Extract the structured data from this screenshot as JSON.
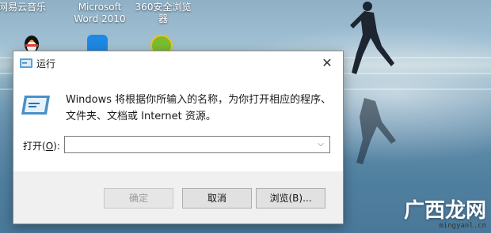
{
  "desktop": {
    "icons": [
      {
        "label": "网易云音乐"
      },
      {
        "label": "Microsoft Word 2010"
      },
      {
        "label": "360安全浏览器"
      }
    ]
  },
  "dialog": {
    "title": "运行",
    "description": "Windows 将根据你所输入的名称，为你打开相应的程序、文件夹、文档或 Internet 资源。",
    "open_label_prefix": "打开(",
    "open_label_key": "O",
    "open_label_suffix": "):",
    "input_value": "",
    "buttons": {
      "ok": "确定",
      "cancel": "取消",
      "browse": "浏览(B)..."
    }
  },
  "watermark": {
    "big": "广西龙网",
    "small": "mingyanl.cn"
  }
}
